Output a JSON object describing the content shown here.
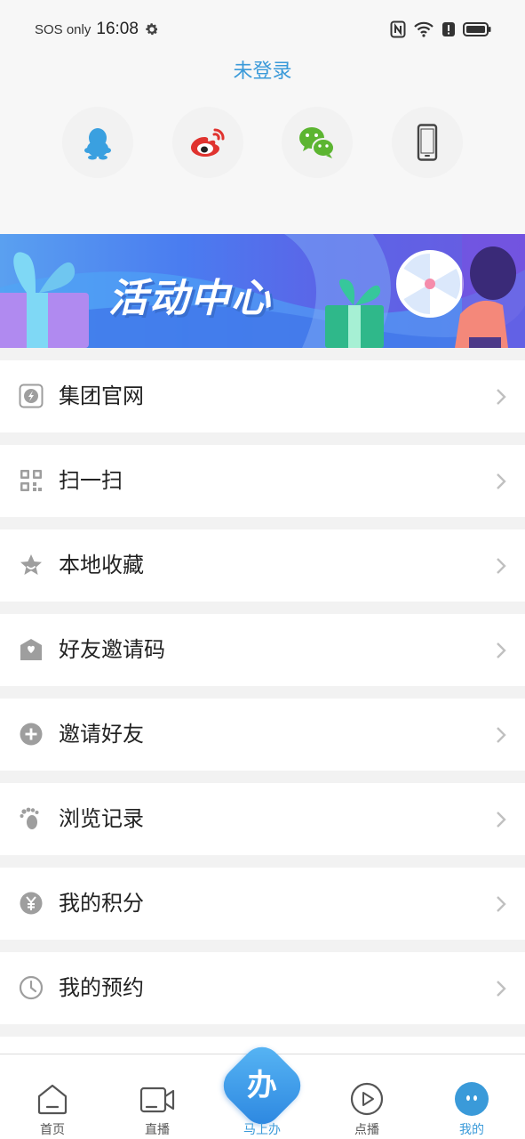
{
  "status_bar": {
    "carrier": "SOS only",
    "time": "16:08",
    "icons": [
      "settings-gear-icon",
      "nfc-icon",
      "wifi-icon",
      "alert-icon",
      "battery-icon"
    ]
  },
  "header": {
    "login_status": "未登录"
  },
  "social_logins": [
    {
      "name": "qq",
      "icon": "qq-penguin-icon",
      "color": "#3aa0e0"
    },
    {
      "name": "weibo",
      "icon": "weibo-icon",
      "color": "#e0332f"
    },
    {
      "name": "wechat",
      "icon": "wechat-icon",
      "color": "#5cb531"
    },
    {
      "name": "phone",
      "icon": "phone-icon",
      "color": "#444444"
    }
  ],
  "banner": {
    "title": "活动中心"
  },
  "menu": {
    "items": [
      {
        "label": "集团官网",
        "icon": "website-icon"
      },
      {
        "label": "扫一扫",
        "icon": "qr-scan-icon"
      },
      {
        "label": "本地收藏",
        "icon": "star-icon"
      },
      {
        "label": "好友邀请码",
        "icon": "invite-code-icon"
      },
      {
        "label": "邀请好友",
        "icon": "plus-circle-icon"
      },
      {
        "label": "浏览记录",
        "icon": "footprint-icon"
      },
      {
        "label": "我的积分",
        "icon": "yen-coin-icon"
      },
      {
        "label": "我的预约",
        "icon": "clock-icon"
      }
    ]
  },
  "tabbar": {
    "tabs": [
      {
        "label": "首页",
        "icon": "home-icon"
      },
      {
        "label": "直播",
        "icon": "video-camera-icon"
      },
      {
        "label": "马上办",
        "icon": "ban-character-icon",
        "center_char": "办"
      },
      {
        "label": "点播",
        "icon": "play-circle-icon"
      },
      {
        "label": "我的",
        "icon": "profile-face-icon",
        "active": true
      }
    ]
  },
  "colors": {
    "accent": "#3a9ad9",
    "menu_icon": "#9e9e9e",
    "chevron": "#c0c0c0"
  }
}
